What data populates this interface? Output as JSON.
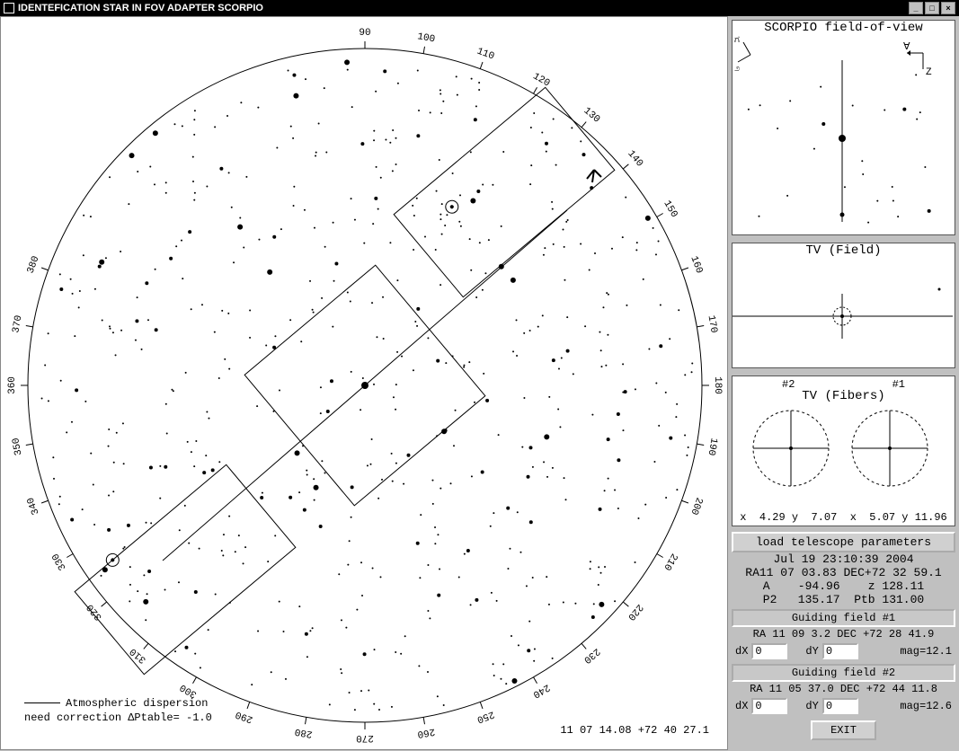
{
  "window": {
    "title": "IDENTEFICATION STAR IN FOV ADAPTER SCORPIO"
  },
  "sky": {
    "ticks": [
      "90",
      "100",
      "110",
      "120",
      "130",
      "140",
      "150",
      "160",
      "170",
      "180",
      "190",
      "200",
      "210",
      "220",
      "230",
      "240",
      "250",
      "260",
      "270",
      "280",
      "290",
      "300",
      "310",
      "320",
      "330",
      "340",
      "350",
      "360",
      "370",
      "380"
    ],
    "legend_ad": "Atmospheric dispersion",
    "legend_corr": "need correction ΔPtable=  -1.0",
    "center_coords": "11 07 14.08  +72 40 27.1"
  },
  "fov": {
    "title": "SCORPIO field-of-view"
  },
  "tv_field": {
    "title": "TV (Field)"
  },
  "tv_fibers": {
    "title": "TV (Fibers)",
    "label1": "#2",
    "label2": "#1",
    "coords": "x  4.29 y  7.07  x  5.07 y 11.96"
  },
  "telescope": {
    "load_button": "load telescope parameters",
    "datetime": "Jul 19 23:10:39 2004",
    "line_radec": "RA11 07 03.83 DEC+72 32 59.1",
    "line_az": "A    -94.96    z 128.11",
    "line_p2": "P2   135.17  Ptb 131.00"
  },
  "guide1": {
    "header": "Guiding field #1",
    "radec": "RA 11 09 3.2 DEC +72 28 41.9",
    "dx_label": "dX",
    "dx_value": "0",
    "dy_label": "dY",
    "dy_value": "0",
    "mag": "mag=12.1"
  },
  "guide2": {
    "header": "Guiding field #2",
    "radec": "RA 11 05 37.0 DEC +72 44 11.8",
    "dx_label": "dX",
    "dx_value": "0",
    "dy_label": "dY",
    "dy_value": "0",
    "mag": "mag=12.6"
  },
  "exit": {
    "label": "EXIT"
  },
  "compass": {
    "n_like": "ಗ",
    "s_like": "೨",
    "a_label": "∀",
    "z_label": "Z"
  }
}
